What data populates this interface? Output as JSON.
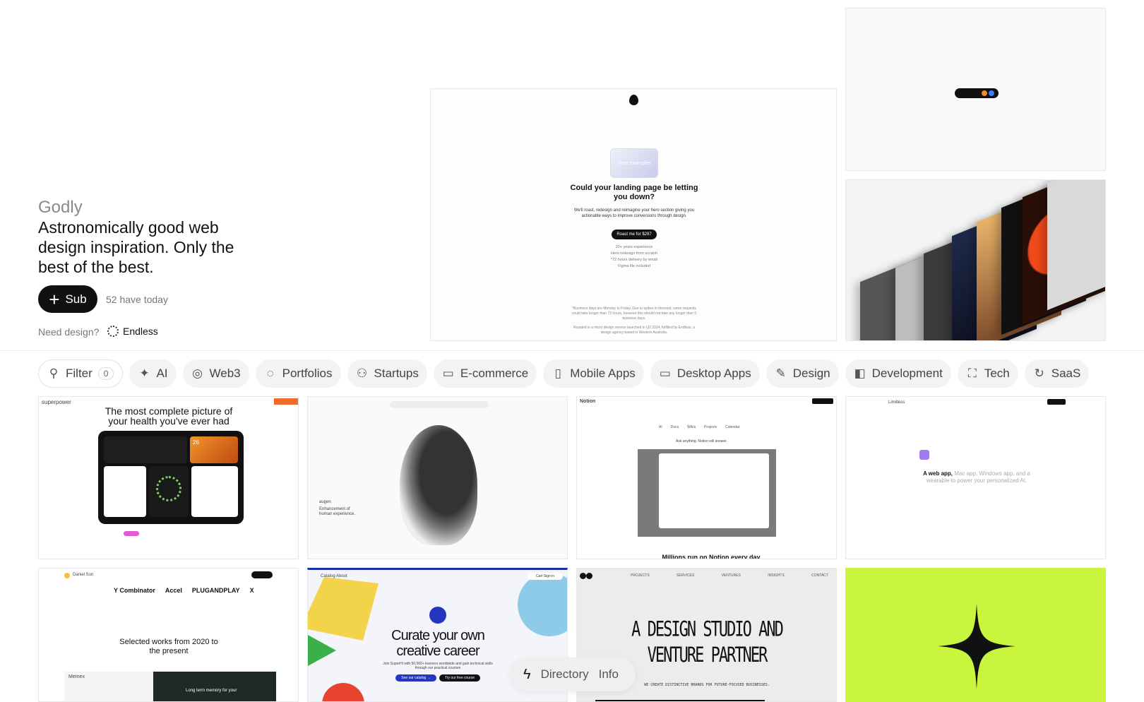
{
  "hero": {
    "brand": "Godly",
    "tagline": "Astronomically good web design inspiration. Only the best of the best.",
    "sub_label": "Sub",
    "today_text": "52 have today",
    "need_design": "Need design?",
    "partner_label": "Endless",
    "feature": {
      "headline": "Could your landing page be letting you down?",
      "body": "We'll roast, redesign and reimagine your hero section giving you actionable ways to improve conversions through design.",
      "cta": "Roast me for $297",
      "points": [
        "20+ years experience",
        "Hero redesign from scratch",
        "*72 hours delivery by email",
        "Figma file included"
      ],
      "card_text": "View examples",
      "footnote": "*Business days are Monday to Friday. Due to spikes in demand, some requests could take longer than 72 hours, however this should not take any longer than 5 business days.",
      "credit": "Roasted is a micro design service launched in Q3 2024, fulfilled by Endless, a design agency based in Western Australia."
    }
  },
  "filters": {
    "filter_label": "Filter",
    "filter_count": "0",
    "chips": [
      {
        "label": "AI",
        "icon": "sparkle-icon",
        "glyph": "✦"
      },
      {
        "label": "Web3",
        "icon": "planet-icon",
        "glyph": "◎"
      },
      {
        "label": "Portfolios",
        "icon": "leaf-icon",
        "glyph": "◌"
      },
      {
        "label": "Startups",
        "icon": "shapes-icon",
        "glyph": "⚇"
      },
      {
        "label": "E-commerce",
        "icon": "credit-card-icon",
        "glyph": "▭"
      },
      {
        "label": "Mobile Apps",
        "icon": "phone-icon",
        "glyph": "▯"
      },
      {
        "label": "Desktop Apps",
        "icon": "window-icon",
        "glyph": "▭"
      },
      {
        "label": "Design",
        "icon": "pen-icon",
        "glyph": "✎"
      },
      {
        "label": "Development",
        "icon": "code-icon",
        "glyph": "◧"
      },
      {
        "label": "Tech",
        "icon": "chip-icon",
        "glyph": "⛶"
      },
      {
        "label": "SaaS",
        "icon": "refresh-icon",
        "glyph": "↻"
      }
    ]
  },
  "grid": {
    "superpower": {
      "logo": "superpower",
      "headline": "The most complete picture of your health you've ever had",
      "card_num": "26"
    },
    "augen": {
      "brand": "augen",
      "body": "Enhancement of human experience."
    },
    "notion": {
      "logo": "Notion",
      "tabs": [
        "AI",
        "Docs",
        "Wikis",
        "Projects",
        "Calendar"
      ],
      "prompt": "Ask anything. Notion will answer.",
      "footer": "Millions run on Notion every day"
    },
    "limitless": {
      "logo": "Limitless",
      "headline_bold": "A web app,",
      "headline_rest": "Mac app, Windows app, and a wearable to power your personalized AI."
    },
    "danielsun": {
      "name": "Daniel Sun",
      "logos": [
        "Y Combinator",
        "Accel",
        "PLUGANDPLAY",
        "X"
      ],
      "headline": "Selected works from 2020 to the present",
      "card": "Memex",
      "card2": "Long term memory for your"
    },
    "superhi": {
      "nav": "Catalog   About",
      "headline": "Curate your own creative career",
      "body": "Join SuperHi with 50,000+ learners worldwide and gain technical skills through our practical courses",
      "btn1": "See our catalog →",
      "btn2": "Try our free course",
      "cart": "Cart  Sign in"
    },
    "studio": {
      "nav": [
        "PROJECTS",
        "SERVICES",
        "VENTURES",
        "INSIGHTS",
        "CONTACT"
      ],
      "headline": "A DESIGN STUDIO AND VENTURE PARTNER",
      "body": "WE CREATE DISTINCTIVE BRANDS FOR FUTURE-FOCUSED BUSINESSES."
    },
    "lime": {
      "accent": "#c9f53f"
    }
  },
  "dock": {
    "directory": "Directory",
    "info": "Info"
  }
}
